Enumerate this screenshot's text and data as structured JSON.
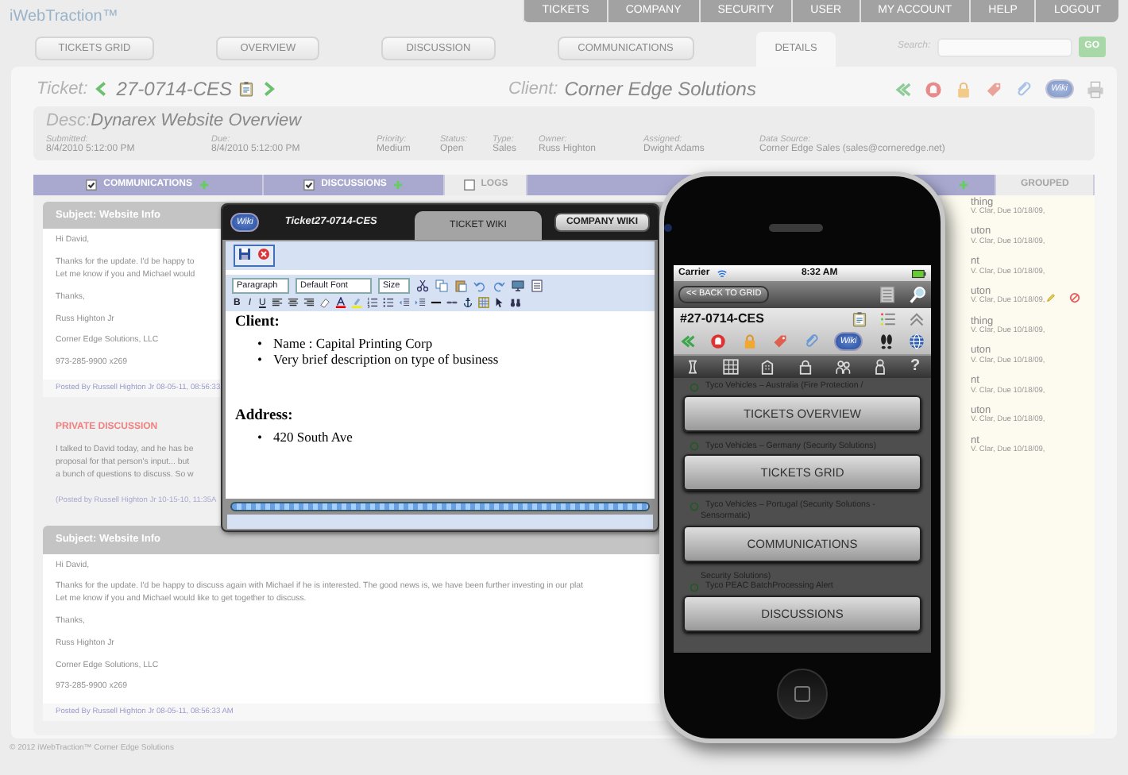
{
  "app": {
    "logo": "iWebTraction™"
  },
  "top_nav": [
    {
      "label": "TICKETS"
    },
    {
      "label": "COMPANY"
    },
    {
      "label": "SECURITY"
    },
    {
      "label": "USER"
    },
    {
      "label": "MY ACCOUNT"
    },
    {
      "label": "HELP"
    },
    {
      "label": "LOGOUT"
    }
  ],
  "tabs": [
    {
      "label": "TICKETS GRID",
      "selected": false
    },
    {
      "label": "OVERVIEW",
      "selected": false
    },
    {
      "label": "DISCUSSION",
      "selected": false
    },
    {
      "label": "COMMUNICATIONS",
      "selected": false
    },
    {
      "label": "DETAILS",
      "selected": true
    }
  ],
  "search": {
    "label": "Search:",
    "button": "GO"
  },
  "ticket": {
    "label": "Ticket:",
    "number": "27-0714-CES",
    "client_label": "Client:",
    "client": "Corner Edge Solutions",
    "wiki_badge": "Wiki"
  },
  "desc": {
    "label": "Desc:",
    "title": "Dynarex Website Overview",
    "fields": [
      {
        "label": "Submitted:",
        "value": "8/4/2010 5:12:00 PM"
      },
      {
        "label": "Due:",
        "value": "8/4/2010 5:12:00 PM"
      },
      {
        "label": "Priority:",
        "value": "Medium"
      },
      {
        "label": "Status:",
        "value": "Open"
      },
      {
        "label": "Type:",
        "value": "Sales"
      },
      {
        "label": "Owner:",
        "value": "Russ Highton"
      },
      {
        "label": "Assigned:",
        "value": "Dwight Adams"
      },
      {
        "label": "Data Source:",
        "value": "Corner Edge Sales (sales@corneredge.net)"
      }
    ]
  },
  "sections": [
    {
      "label": "COMMUNICATIONS",
      "checked": true
    },
    {
      "label": "DISCUSSIONS",
      "checked": true
    },
    {
      "label": "LOGS",
      "checked": false
    }
  ],
  "side_tab": {
    "label": "GROUPED"
  },
  "messages": [
    {
      "kind": "email",
      "subject": "Subject: Website Info",
      "paragraphs": [
        [
          "Hi David,"
        ],
        [
          "Thanks for the update. I'd be happy to",
          "Let me know if you and Michael would"
        ],
        [
          "Thanks,"
        ],
        [
          "Russ Highton Jr"
        ],
        [
          "Corner Edge Solutions, LLC"
        ],
        [
          "973-285-9900 x269"
        ]
      ],
      "posted": "Posted By Russell Highton Jr 08-05-11, 08:56:33"
    },
    {
      "kind": "private",
      "subject": "PRIVATE DISCUSSION",
      "paragraphs": [
        [
          "I talked to David today, and he has be",
          "proposal for that person's input... but",
          "a bunch of questions to discuss. So w"
        ]
      ],
      "posted": "(Posted by Russell Highton Jr 10-15-10, 11:35A"
    },
    {
      "kind": "email",
      "subject": "Subject: Website Info",
      "paragraphs": [
        [
          "Hi David,"
        ],
        [
          "Thanks for the update. I'd be happy to discuss again with Michael if he is interested. The good news is, we have been further investing in our plat",
          "Let me know if you and Michael would like to get together to discuss."
        ],
        [
          "Thanks,"
        ],
        [
          "Russ Highton Jr"
        ],
        [
          "Corner Edge Solutions, LLC"
        ],
        [
          "973-285-9900 x269"
        ]
      ],
      "posted": "Posted By Russell Highton Jr 08-05-11, 08:56:33 AM"
    }
  ],
  "tasks": [
    {
      "title": "thing",
      "meta": "V. Clar, Due 10/18/09,",
      "actions": false
    },
    {
      "title": "uton",
      "meta": "V. Clar, Due 10/18/09,",
      "actions": false
    },
    {
      "title": "nt",
      "meta": "V. Clar, Due 10/18/09,",
      "actions": false
    },
    {
      "title": "uton",
      "meta": "V. Clar, Due 10/18/09,",
      "actions": true
    },
    {
      "title": "thing",
      "meta": "V. Clar, Due 10/18/09,",
      "actions": false
    },
    {
      "title": "uton",
      "meta": "V. Clar, Due 10/18/09,",
      "actions": false
    },
    {
      "title": "nt",
      "meta": "V. Clar, Due 10/18/09,",
      "actions": false
    },
    {
      "title": "uton",
      "meta": "V. Clar, Due 10/18/09,",
      "actions": false
    },
    {
      "title": "nt",
      "meta": "V. Clar, Due 10/18/09,",
      "actions": false
    }
  ],
  "wiki": {
    "badge": "Wiki",
    "ticket": "Ticket27-0714-CES",
    "tabs": [
      {
        "label": "TICKET WIKI",
        "selected": true
      },
      {
        "label": "COMPANY WIKI",
        "selected": false
      }
    ],
    "selects": [
      "Paragraph",
      "Default Font",
      "Size"
    ],
    "format_buttons": [
      "B",
      "I",
      "U"
    ],
    "content": [
      {
        "kind": "heading",
        "text": "Client:"
      },
      {
        "kind": "bullet",
        "marker": "•",
        "text": "Name : Capital Printing Corp"
      },
      {
        "kind": "bullet",
        "marker": "•",
        "text": "Very brief description on type of business"
      },
      {
        "kind": "heading",
        "text": "Address:"
      },
      {
        "kind": "bullet",
        "marker": "•",
        "text": "420 South Ave"
      }
    ]
  },
  "phone": {
    "carrier": "Carrier",
    "time": "8:32 AM",
    "back": "<< BACK TO GRID",
    "ticket": "#27-0714-CES",
    "wiki_badge": "Wiki",
    "help": "?",
    "menu": [
      {
        "label": "TICKETS OVERVIEW",
        "tree": [
          {
            "text": "Tyco Vehicles – Australia (Fire Protection /",
            "node": true
          }
        ]
      },
      {
        "label": "TICKETS GRID",
        "tree": [
          {
            "text": "Tyco Vehicles – Germany (Security Solutions)",
            "node": true
          }
        ]
      },
      {
        "label": "COMMUNICATIONS",
        "tree": [
          {
            "text": "Tyco Vehicles – Portugal (Security Solutions -",
            "node": true
          },
          {
            "text": "Sensormatic)",
            "node": false
          }
        ]
      },
      {
        "label": "DISCUSSIONS",
        "tree": [
          {
            "text": "Security Solutions)",
            "node": false
          },
          {
            "text": "Tyco PEAC BatchProcessing Alert",
            "node": true
          }
        ]
      }
    ]
  },
  "footer": "© 2012 iWebTraction™ Corner Edge Solutions"
}
